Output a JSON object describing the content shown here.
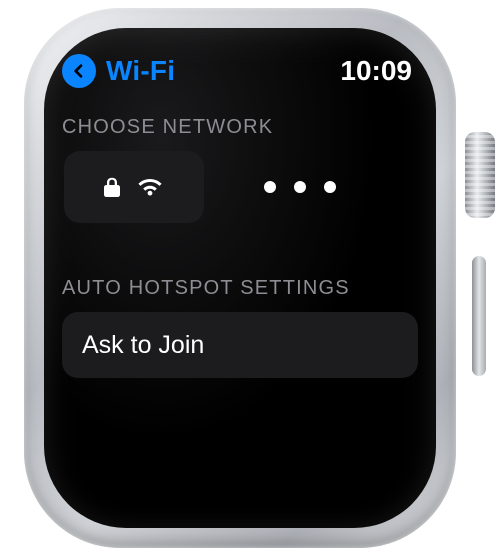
{
  "status": {
    "time": "10:09"
  },
  "header": {
    "title": "Wi-Fi"
  },
  "sections": {
    "choose_network_label": "CHOOSE NETWORK",
    "auto_hotspot_label": "AUTO HOTSPOT SETTINGS"
  },
  "network": {
    "secured": true,
    "signal_icon": "wifi-icon",
    "lock_icon": "lock-icon",
    "loading_icon": "loading-dots"
  },
  "auto_hotspot": {
    "option_label": "Ask to Join"
  },
  "colors": {
    "accent": "#0a84ff",
    "card": "#1c1c1e",
    "muted": "#8d8d93"
  }
}
